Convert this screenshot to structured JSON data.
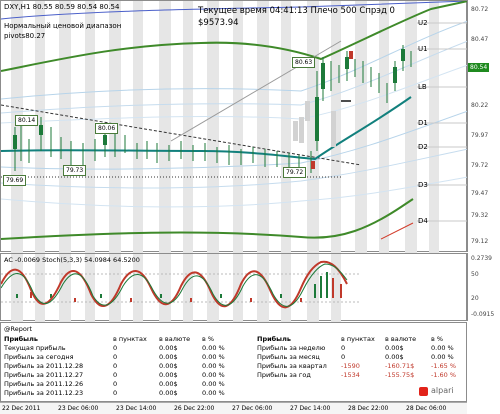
{
  "main_chart": {
    "symbol_line": "DXY,H1  80.55 80.59 80.54 80.54",
    "indicator_name": "Нормальный ценовой диапазон",
    "pivot_line": "pivots80.27",
    "time_line": "Текущее время 04:41:13 Плечо 500 Спрэд 0",
    "balance": "$9573.94",
    "level_labels": [
      "U2",
      "U1",
      "LB",
      "D1",
      "D2",
      "D3",
      "D4"
    ],
    "price_pills": [
      "80.63",
      "80.14",
      "80.06",
      "79.73",
      "79.69",
      "79.72"
    ],
    "price_axis": [
      "80.72",
      "80.47",
      "80.22",
      "79.97",
      "79.72",
      "79.47",
      "79.32",
      "79.12"
    ],
    "current_price": "80.54",
    "accent_current": "#1f8a1f"
  },
  "oscillator": {
    "header": "AC -0.0069   Stoch(5,3,3) 54.0984 64.5200",
    "axis": [
      "0.2739",
      "50",
      "20",
      "-0.0915"
    ]
  },
  "report": {
    "title": "@Report",
    "left_headers": [
      "Прибыль",
      "в пунктах",
      "в валюте",
      "в %"
    ],
    "left_rows": [
      {
        "label": "Текущая прибыль",
        "points": "0",
        "currency": "0.00$",
        "percent": "0.00 %"
      },
      {
        "label": "Прибыль за сегодня",
        "points": "0",
        "currency": "0.00$",
        "percent": "0.00 %"
      },
      {
        "label": "Прибыль за 2011.12.28",
        "points": "0",
        "currency": "0.00$",
        "percent": "0.00 %"
      },
      {
        "label": "Прибыль за 2011.12.27",
        "points": "0",
        "currency": "0.00$",
        "percent": "0.00 %"
      },
      {
        "label": "Прибыль за 2011.12.26",
        "points": "0",
        "currency": "0.00$",
        "percent": "0.00 %"
      },
      {
        "label": "Прибыль за 2011.12.23",
        "points": "0",
        "currency": "0.00$",
        "percent": "0.00 %"
      }
    ],
    "right_headers": [
      "Прибыль",
      "в пунктах",
      "в валюте",
      "в %"
    ],
    "right_rows": [
      {
        "label": "Прибыль за неделю",
        "points": "0",
        "currency": "0.00$",
        "percent": "0.00 %"
      },
      {
        "label": "Прибыль за месяц",
        "points": "0",
        "currency": "0.00$",
        "percent": "0.00 %"
      },
      {
        "label": "Прибыль за квартал",
        "points": "-1590",
        "currency": "-160.71$",
        "percent": "-1.65 %"
      },
      {
        "label": "Прибыль за год",
        "points": "-1534",
        "currency": "-155.75$",
        "percent": "-1.60 %"
      }
    ],
    "logo": "alpari"
  },
  "time_axis": [
    "22 Dec 2011",
    "23 Dec 06:00",
    "23 Dec 14:00",
    "26 Dec 22:00",
    "27 Dec 06:00",
    "27 Dec 14:00",
    "28 Dec 22:00",
    "28 Dec 06:00"
  ]
}
